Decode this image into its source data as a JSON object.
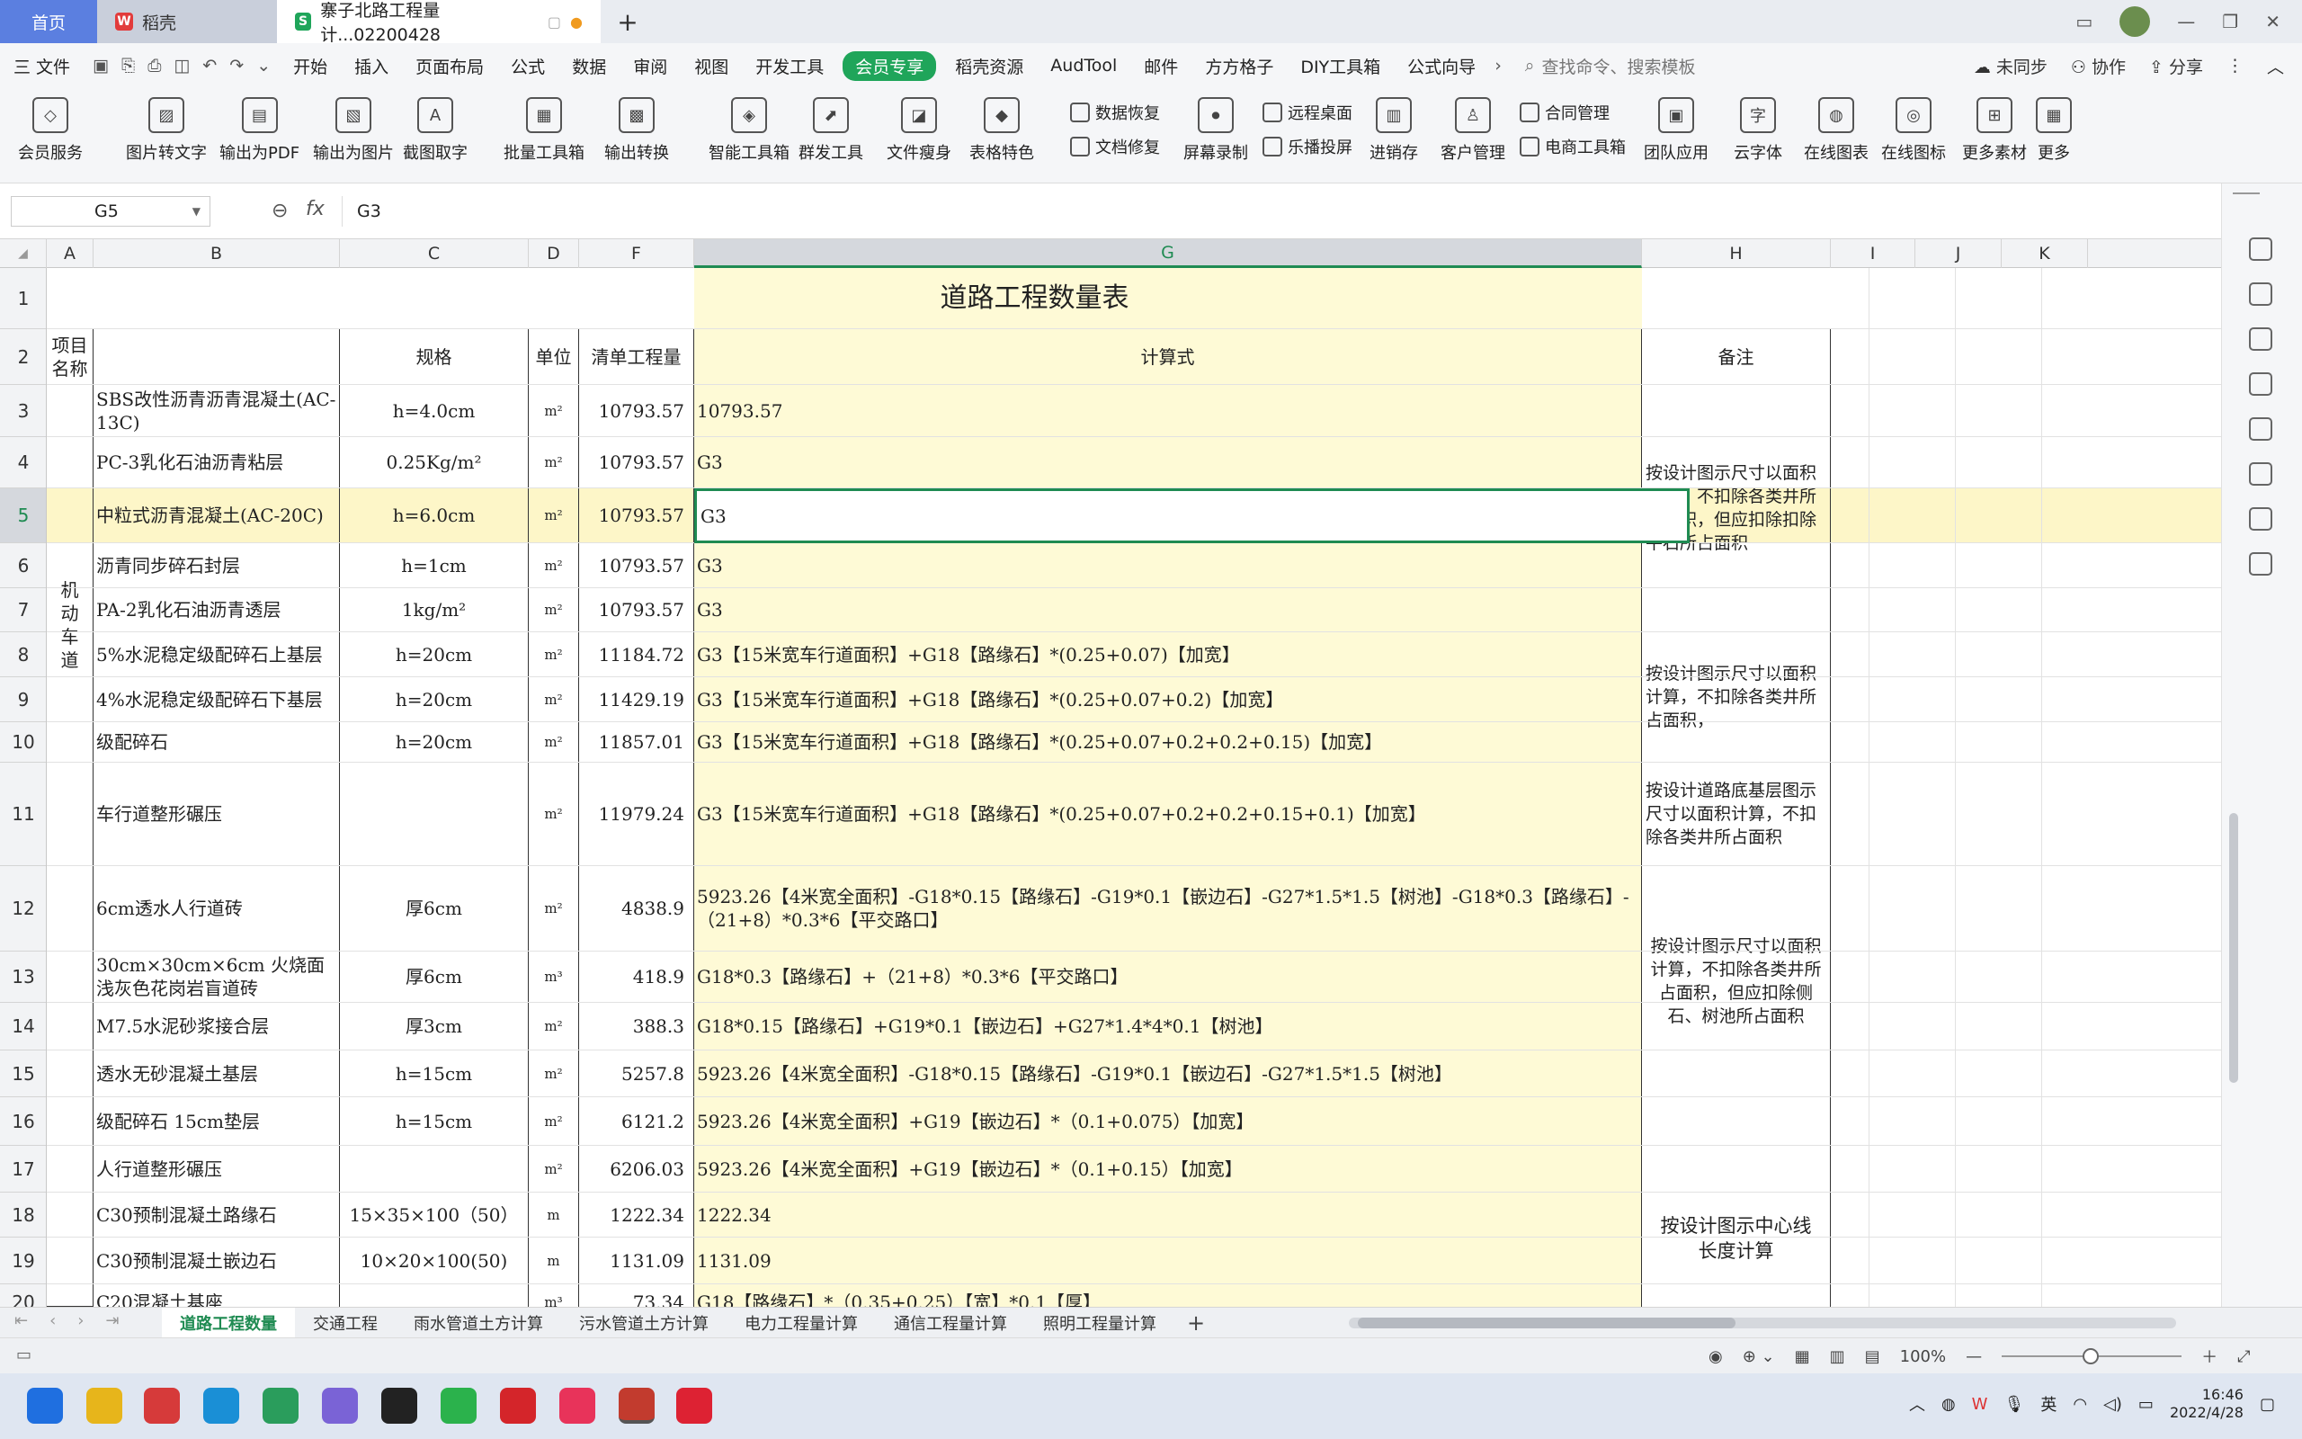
{
  "tabs": {
    "home": "首页",
    "daoke": "稻壳",
    "doc": "寨子北路工程量计...02200428"
  },
  "menu": {
    "file": "三 文件",
    "items": [
      "开始",
      "插入",
      "页面布局",
      "公式",
      "数据",
      "审阅",
      "视图",
      "开发工具",
      "会员专享",
      "稻壳资源",
      "AudTool",
      "邮件",
      "方方格子",
      "DIY工具箱",
      "公式向导"
    ],
    "active": "会员专享",
    "search_placeholder": "查找命令、搜索模板",
    "sync": "未同步",
    "collab": "协作",
    "share": "分享"
  },
  "ribbon": {
    "big": [
      "会员服务",
      "图片转文字",
      "输出为PDF",
      "输出为图片",
      "截图取字",
      "批量工具箱",
      "输出转换",
      "智能工具箱",
      "群发工具",
      "文件瘦身",
      "表格特色",
      "屏幕录制",
      "进销存",
      "客户管理",
      "团队应用",
      "云字体",
      "在线图表",
      "在线图标",
      "更多素材",
      "更多"
    ],
    "small": [
      "数据恢复",
      "文档修复",
      "远程桌面",
      "乐播投屏",
      "合同管理",
      "电商工具箱"
    ]
  },
  "formula": {
    "name_box": "G5",
    "fx": "fx",
    "value": "G3"
  },
  "columns": [
    "A",
    "B",
    "C",
    "D",
    "F",
    "G",
    "H",
    "I",
    "J",
    "K"
  ],
  "rows": [
    "1",
    "2",
    "3",
    "4",
    "5",
    "6",
    "7",
    "8",
    "9",
    "10",
    "11",
    "12",
    "13",
    "14",
    "15",
    "16",
    "17",
    "18",
    "19",
    "20"
  ],
  "sheet": {
    "title": "道路工程数量表",
    "headers": {
      "a": "项目名称",
      "c": "规格",
      "d": "单位",
      "f": "清单工程量",
      "g": "计算式",
      "h": "备注"
    },
    "group1": "机动车道",
    "data": [
      {
        "b": "SBS改性沥青沥青混凝土(AC-13C)",
        "c": "h=4.0cm",
        "d": "m²",
        "f": "10793.57",
        "g": "10793.57"
      },
      {
        "b": "PC-3乳化石油沥青粘层",
        "c": "0.25Kg/m²",
        "d": "m²",
        "f": "10793.57",
        "g": "G3"
      },
      {
        "b": "中粒式沥青混凝土(AC-20C)",
        "c": "h=6.0cm",
        "d": "m²",
        "f": "10793.57",
        "g": "G3"
      },
      {
        "b": "沥青同步碎石封层",
        "c": "h=1cm",
        "d": "m²",
        "f": "10793.57",
        "g": "G3"
      },
      {
        "b": "PA-2乳化石油沥青透层",
        "c": "1kg/m²",
        "d": "m²",
        "f": "10793.57",
        "g": "G3"
      },
      {
        "b": "5%水泥稳定级配碎石上基层",
        "c": "h=20cm",
        "d": "m²",
        "f": "11184.72",
        "g": "G3【15米宽车行道面积】+G18【路缘石】*(0.25+0.07)【加宽】"
      },
      {
        "b": "4%水泥稳定级配碎石下基层",
        "c": "h=20cm",
        "d": "m²",
        "f": "11429.19",
        "g": "G3【15米宽车行道面积】+G18【路缘石】*(0.25+0.07+0.2)【加宽】"
      },
      {
        "b": "级配碎石",
        "c": "h=20cm",
        "d": "m²",
        "f": "11857.01",
        "g": "G3【15米宽车行道面积】+G18【路缘石】*(0.25+0.07+0.2+0.2+0.15)【加宽】"
      },
      {
        "b": "车行道整形碾压",
        "c": "",
        "d": "m²",
        "f": "11979.24",
        "g": "G3【15米宽车行道面积】+G18【路缘石】*(0.25+0.07+0.2+0.2+0.15+0.1)【加宽】"
      },
      {
        "b": "6cm透水人行道砖",
        "c": "厚6cm",
        "d": "m²",
        "f": "4838.9",
        "g": "5923.26【4米宽全面积】-G18*0.15【路缘石】-G19*0.1【嵌边石】-G27*1.5*1.5【树池】-G18*0.3【路缘石】-（21+8）*0.3*6【平交路口】"
      },
      {
        "b": "30cm×30cm×6cm 火烧面浅灰色花岗岩盲道砖",
        "c": "厚6cm",
        "d": "m³",
        "f": "418.9",
        "g": "G18*0.3【路缘石】+（21+8）*0.3*6【平交路口】"
      },
      {
        "b": "M7.5水泥砂浆接合层",
        "c": "厚3cm",
        "d": "m²",
        "f": "388.3",
        "g": "G18*0.15【路缘石】+G19*0.1【嵌边石】+G27*1.4*4*0.1【树池】"
      },
      {
        "b": "透水无砂混凝土基层",
        "c": "h=15cm",
        "d": "m²",
        "f": "5257.8",
        "g": "5923.26【4米宽全面积】-G18*0.15【路缘石】-G19*0.1【嵌边石】-G27*1.5*1.5【树池】"
      },
      {
        "b": "级配碎石 15cm垫层",
        "c": "h=15cm",
        "d": "m²",
        "f": "6121.2",
        "g": "5923.26【4米宽全面积】+G19【嵌边石】*（0.1+0.075）【加宽】"
      },
      {
        "b": "人行道整形碾压",
        "c": "",
        "d": "m²",
        "f": "6206.03",
        "g": "5923.26【4米宽全面积】+G19【嵌边石】*（0.1+0.15）【加宽】"
      },
      {
        "b": "C30预制混凝土路缘石",
        "c": "15×35×100（50）",
        "d": "m",
        "f": "1222.34",
        "g": "1222.34"
      },
      {
        "b": "C30预制混凝土嵌边石",
        "c": "10×20×100(50)",
        "d": "m",
        "f": "1131.09",
        "g": "1131.09"
      },
      {
        "b": "C20混凝土基座",
        "c": "",
        "d": "m³",
        "f": "73.34",
        "g": "G18【路缘石】*（0.35+0.25）【宽】*0.1【厚】"
      }
    ],
    "notes": [
      "按设计图示尺寸以面积计算，不扣除各类井所占面积，但应扣除扣除平石所占面积",
      "按设计图示尺寸以面积计算，不扣除各类井所占面积，",
      "按设计道路底基层图示尺寸以面积计算，不扣除各类井所占面积",
      "按设计图示尺寸以面积计算，不扣除各类井所占面积，但应扣除侧石、树池所占面积",
      "按设计图示中心线长度计算"
    ]
  },
  "sheet_tabs": [
    "道路工程数量",
    "交通工程",
    "雨水管道土方计算",
    "污水管道土方计算",
    "电力工程量计算",
    "通信工程量计算",
    "照明工程量计算"
  ],
  "status": {
    "zoom": "100%"
  },
  "taskbar": {
    "ime": "英",
    "time": "16:46",
    "date": "2022/4/28"
  }
}
